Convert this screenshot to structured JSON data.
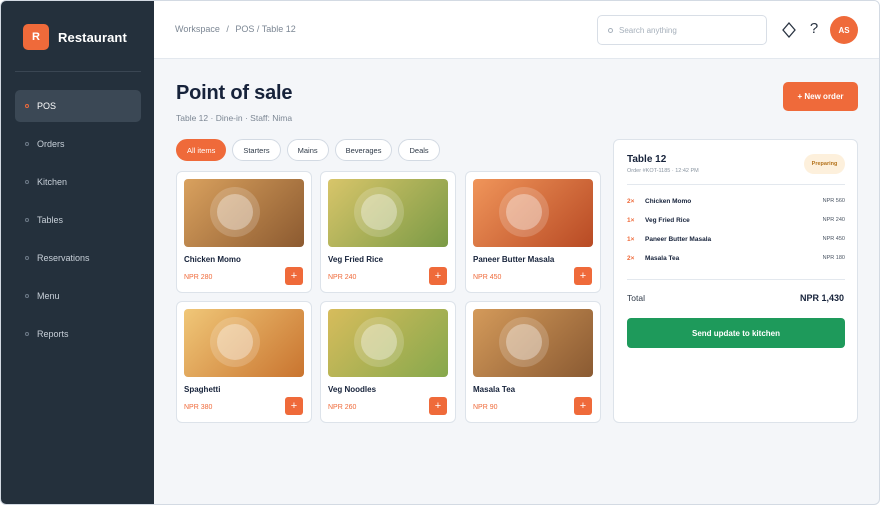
{
  "app": {
    "logo_letter": "R",
    "name": "Restaurant"
  },
  "sidebar": {
    "items": [
      {
        "label": "POS",
        "active": true
      },
      {
        "label": "Orders",
        "active": false
      },
      {
        "label": "Kitchen",
        "active": false
      },
      {
        "label": "Tables",
        "active": false
      },
      {
        "label": "Reservations",
        "active": false
      },
      {
        "label": "Menu",
        "active": false
      },
      {
        "label": "Reports",
        "active": false
      }
    ]
  },
  "header": {
    "breadcrumb": [
      "Workspace",
      "POS / Table 12"
    ],
    "breadcrumb_separator": "/",
    "search_placeholder": "Search anything",
    "help_glyph": "?",
    "avatar_initials": "AS"
  },
  "page": {
    "title": "Point of sale",
    "subtitle": "Table 12 · Dine-in · Staff: Nima",
    "new_order_label": "+ New order"
  },
  "filters": [
    {
      "label": "All items",
      "active": true
    },
    {
      "label": "Starters",
      "active": false
    },
    {
      "label": "Mains",
      "active": false
    },
    {
      "label": "Beverages",
      "active": false
    },
    {
      "label": "Deals",
      "active": false
    }
  ],
  "products": [
    {
      "name": "Chicken Momo",
      "price": "NPR 280",
      "colors": [
        "#d9a15e",
        "#8c5a30"
      ]
    },
    {
      "name": "Veg Fried Rice",
      "price": "NPR 240",
      "colors": [
        "#d8c56a",
        "#7a9a45"
      ]
    },
    {
      "name": "Paneer Butter Masala",
      "price": "NPR 450",
      "colors": [
        "#f0955a",
        "#b84a24"
      ]
    },
    {
      "name": "Spaghetti",
      "price": "NPR 380",
      "colors": [
        "#f0c778",
        "#c9742f"
      ]
    },
    {
      "name": "Veg Noodles",
      "price": "NPR 260",
      "colors": [
        "#d7bc5c",
        "#86a84c"
      ]
    },
    {
      "name": "Masala Tea",
      "price": "NPR 90",
      "colors": [
        "#d49a5a",
        "#8a5a32"
      ]
    }
  ],
  "add_label": "+",
  "order": {
    "title": "Table 12",
    "meta": "Order #KOT-1185 · 12:42 PM",
    "status": "Preparing",
    "lines": [
      {
        "qty": "2×",
        "name": "Chicken Momo",
        "price": "NPR 560"
      },
      {
        "qty": "1×",
        "name": "Veg Fried Rice",
        "price": "NPR 240"
      },
      {
        "qty": "1×",
        "name": "Paneer Butter Masala",
        "price": "NPR 450"
      },
      {
        "qty": "2×",
        "name": "Masala Tea",
        "price": "NPR 180"
      }
    ],
    "total_label": "Total",
    "total_value": "NPR 1,430",
    "send_label": "Send update to kitchen"
  },
  "colors": {
    "accent": "#ef6a3a",
    "sidebar": "#24303c",
    "success": "#1e9a5b"
  }
}
